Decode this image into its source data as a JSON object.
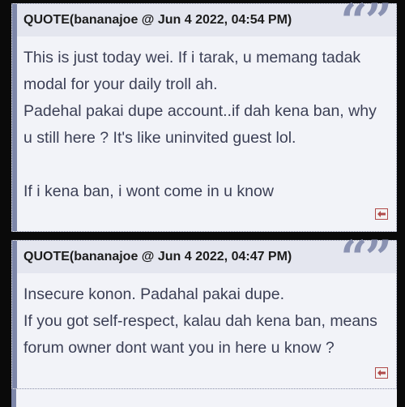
{
  "quotes": [
    {
      "author": "QUOTE(bananajoe @ Jun 4 2022, 04:54 PM)",
      "quote_mark": "“”",
      "lines": [
        "This is just today wei. If i tarak, u memang tadak",
        "modal for your daily troll ah.",
        "Padehal pakai dupe account..if dah kena ban, why",
        "u still here ? It's like uninvited guest lol.",
        "",
        "If i kena ban, i wont come in u know"
      ]
    },
    {
      "author": "QUOTE(bananajoe @ Jun 4 2022, 04:47 PM)",
      "quote_mark": "“”",
      "lines": [
        "Insecure konon. Padahal pakai dupe.",
        "If you got self-respect, kalau dah kena ban, means",
        "forum owner dont want you in here u know ?"
      ]
    }
  ],
  "icons": {
    "quote_mark": "quote-icon",
    "back": "back-to-post-icon"
  },
  "colors": {
    "box_bg": "#f2f3f8",
    "header_bg": "#e4e6ef",
    "accent_bar": "#7d86a8",
    "quote_mark": "#8a92b2",
    "body_text": "#3c4056",
    "back_icon": "#b04a4a"
  }
}
